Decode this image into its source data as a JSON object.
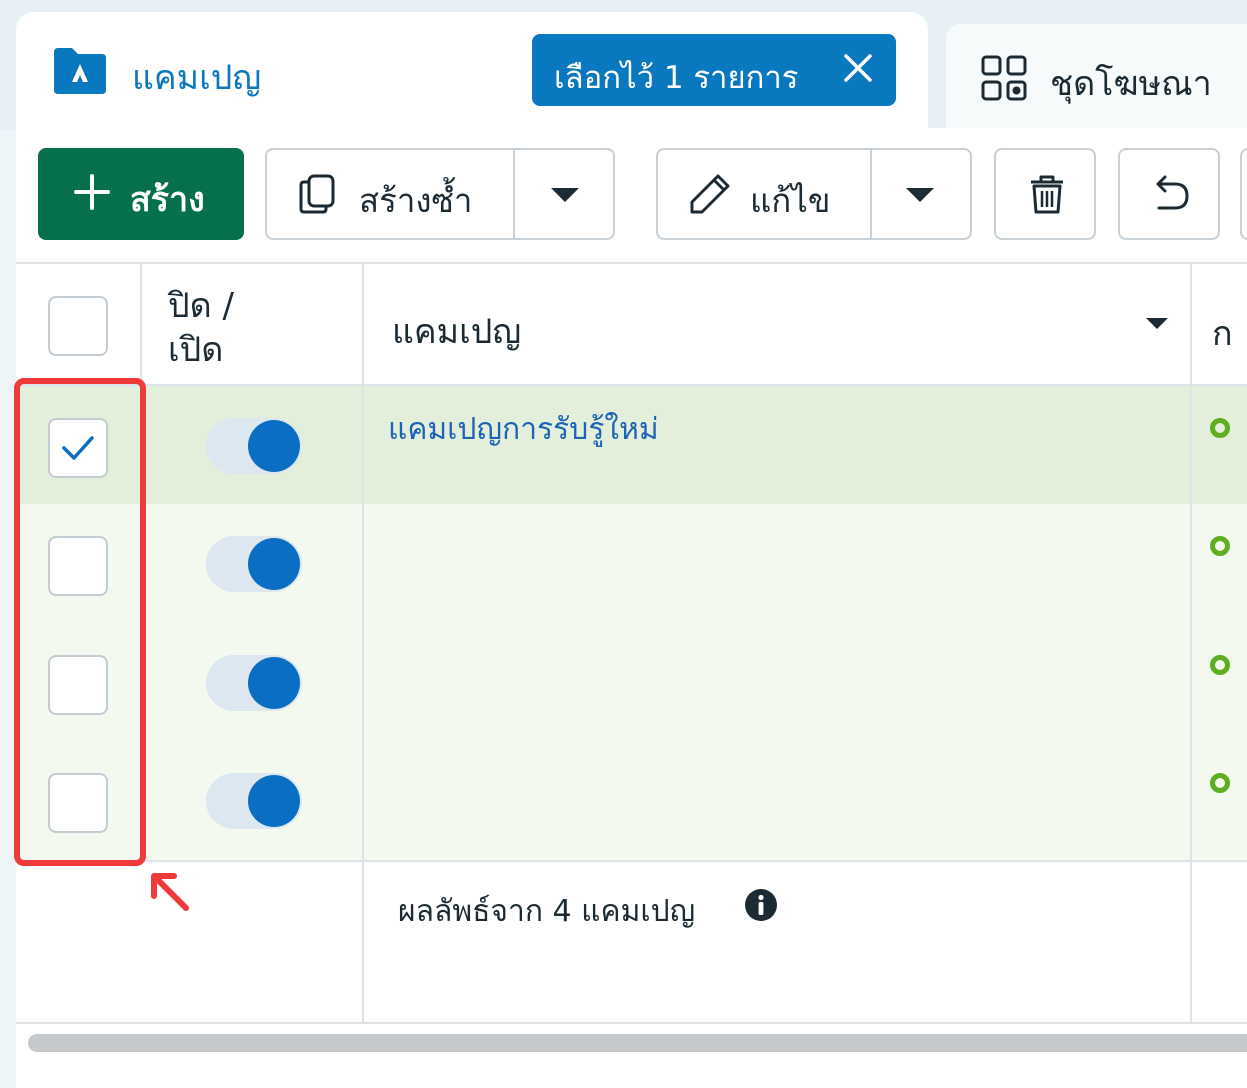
{
  "tabs": {
    "campaign_label": "แคมเปญ",
    "selection_badge": "เลือกไว้ 1 รายการ",
    "adset_label": "ชุดโฆษณา"
  },
  "toolbar": {
    "create_label": "สร้าง",
    "duplicate_label": "สร้างซ้ำ",
    "edit_label": "แก้ไข"
  },
  "table": {
    "headers": {
      "on_off": "ปิด /",
      "on_off_2": "เปิด",
      "campaign": "แคมเปญ",
      "next": "ก"
    },
    "rows": [
      {
        "name": "แคมเปญการรับรู้ใหม่",
        "selected": true,
        "enabled": true
      },
      {
        "name": "",
        "selected": false,
        "enabled": true
      },
      {
        "name": "",
        "selected": false,
        "enabled": true
      },
      {
        "name": "",
        "selected": false,
        "enabled": true
      }
    ],
    "footer": "ผลลัพธ์จาก 4 แคมเปญ"
  },
  "colors": {
    "primary_blue": "#0a78be",
    "create_green": "#06704b",
    "selected_row": "#e3efda",
    "status_green": "#5fae1f",
    "annotation_red": "#ef3a3a"
  }
}
